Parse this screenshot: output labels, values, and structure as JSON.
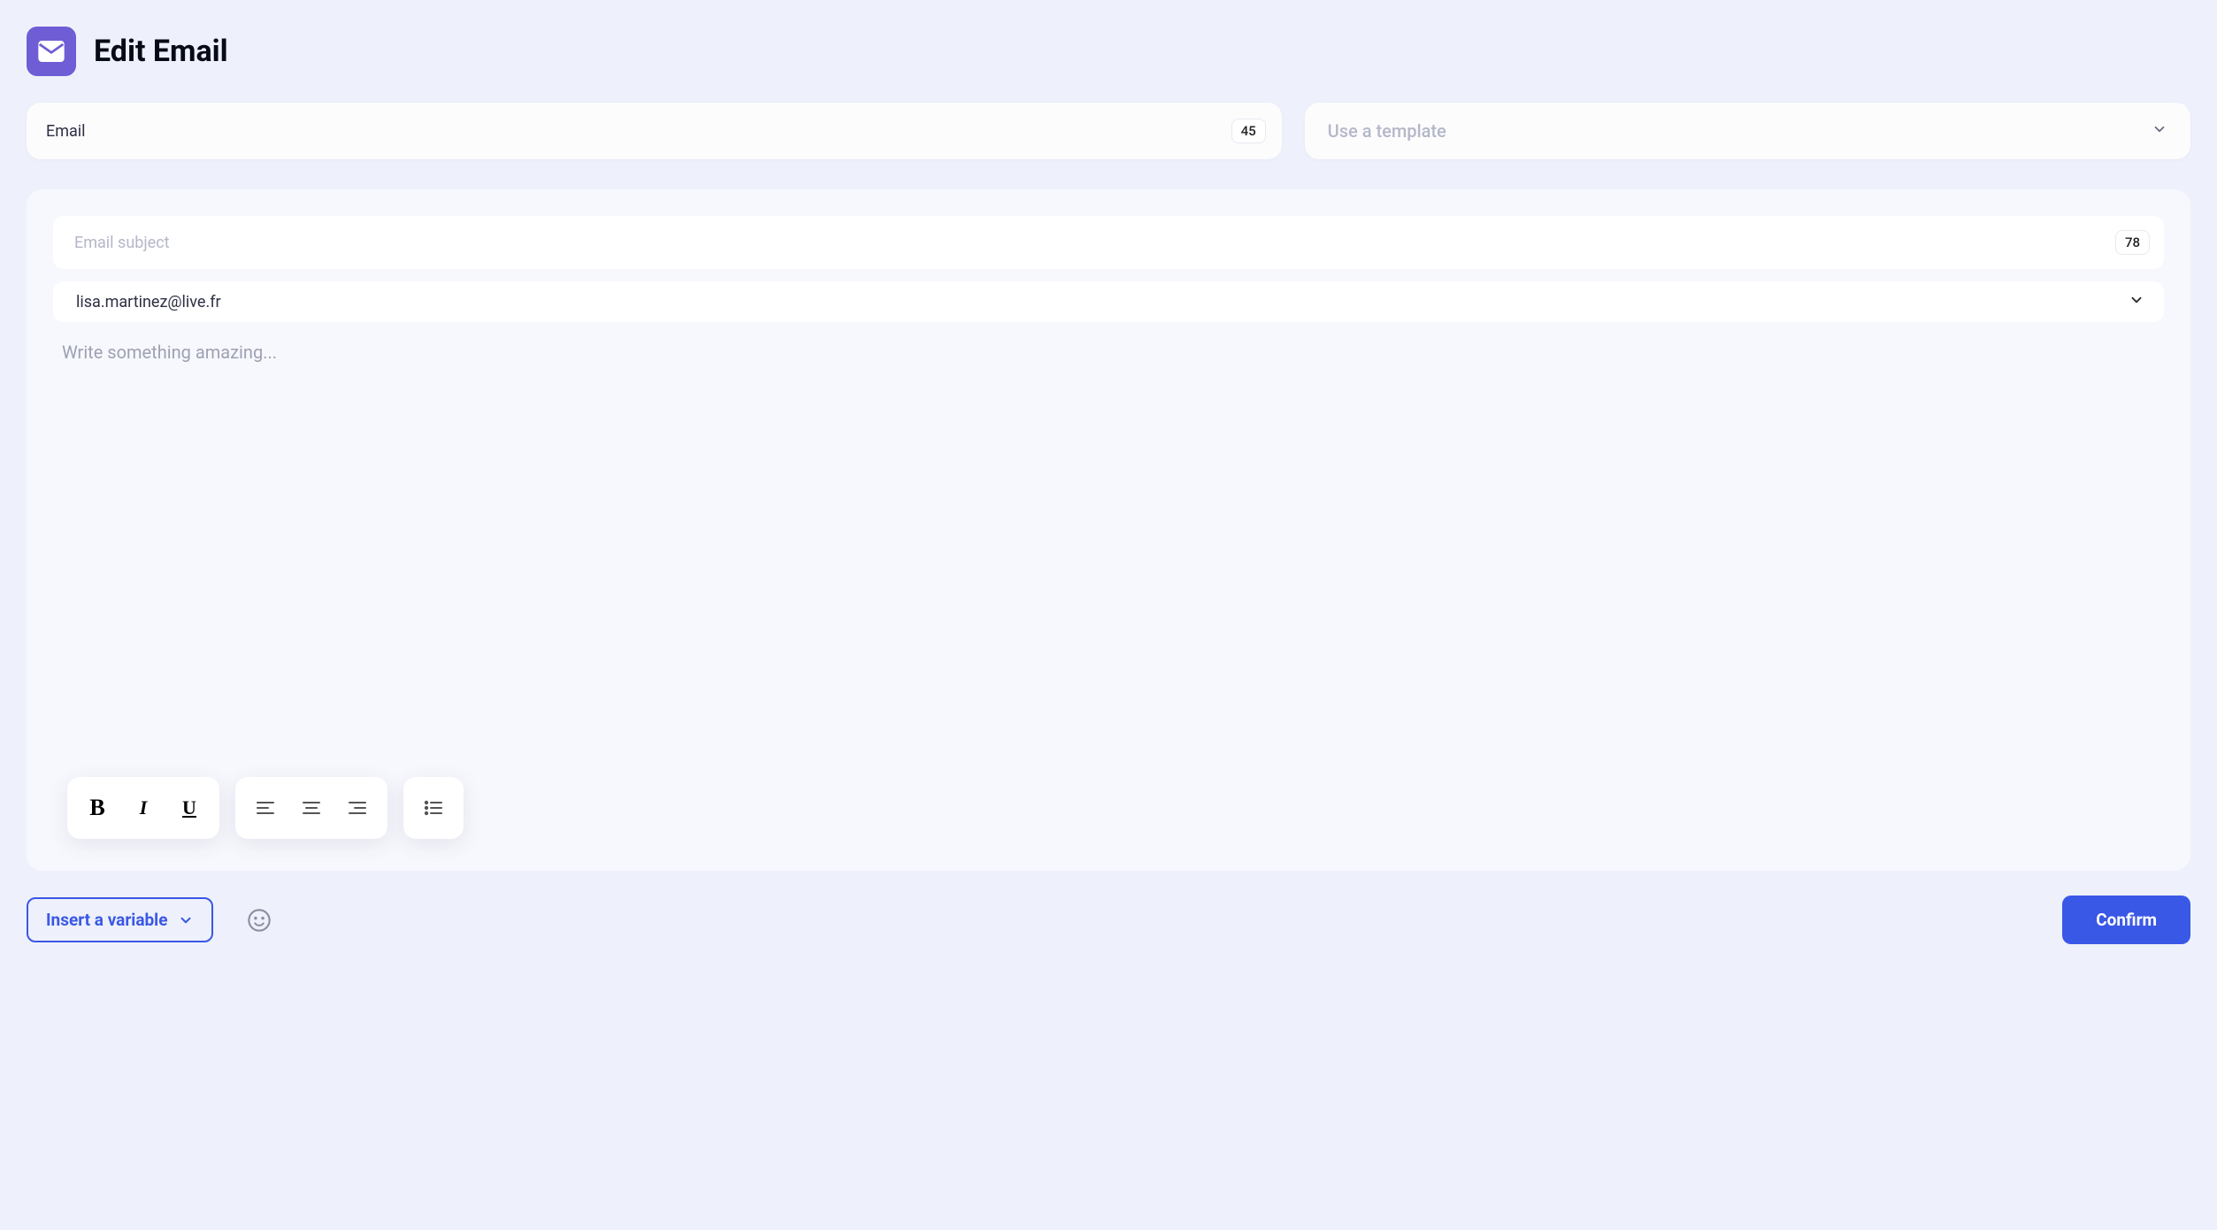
{
  "header": {
    "title": "Edit Email"
  },
  "emailInfo": {
    "label": "Email",
    "count": "45"
  },
  "templateSelect": {
    "placeholder": "Use a template"
  },
  "subject": {
    "placeholder": "Email subject",
    "count": "78"
  },
  "sender": {
    "value": "lisa.martinez@live.fr"
  },
  "body": {
    "placeholder": "Write something amazing..."
  },
  "footer": {
    "insertVariable": "Insert a variable",
    "confirm": "Confirm"
  }
}
